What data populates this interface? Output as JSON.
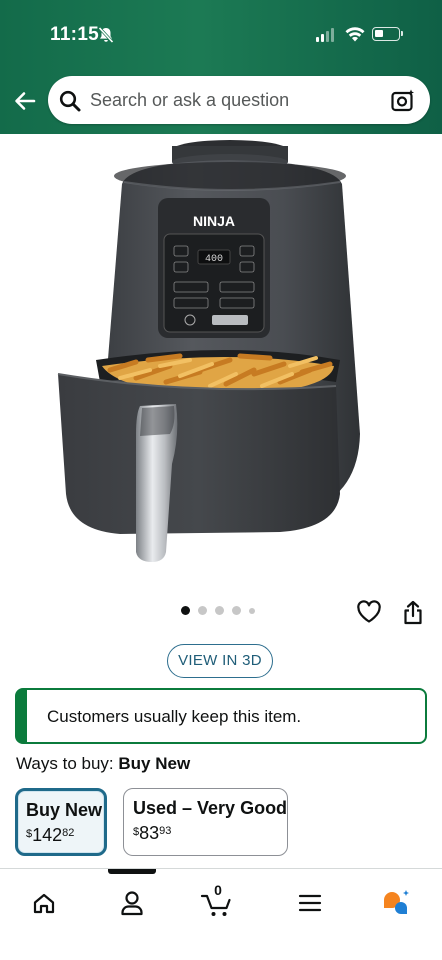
{
  "status_bar": {
    "time": "11:15"
  },
  "search": {
    "placeholder": "Search or ask a question"
  },
  "product": {
    "brand_label": "NINJA",
    "display_reading": "400",
    "carousel": {
      "total_images": 5,
      "active_index": 0
    }
  },
  "view_3d": {
    "label": "VIEW IN 3D"
  },
  "notice": {
    "text": "Customers usually keep this item."
  },
  "ways_to_buy": {
    "prefix": "Ways to buy:",
    "selected": "Buy New",
    "options": [
      {
        "title": "Buy New",
        "currency": "$",
        "whole": "142",
        "fraction": "82",
        "selected": true
      },
      {
        "title": "Used – Very Good",
        "currency": "$",
        "whole": "83",
        "fraction": "93",
        "selected": false
      }
    ]
  },
  "bottom_nav": {
    "items": [
      "home-icon",
      "account-icon",
      "cart-icon",
      "menu-icon",
      "rufus-icon"
    ],
    "cart_count": "0",
    "active_index": 1
  },
  "colors": {
    "header_green": "#1c7a54",
    "accent_teal": "#1f6a8a",
    "notice_green": "#0b7b3c",
    "appliance_body": "#4a4d52"
  }
}
